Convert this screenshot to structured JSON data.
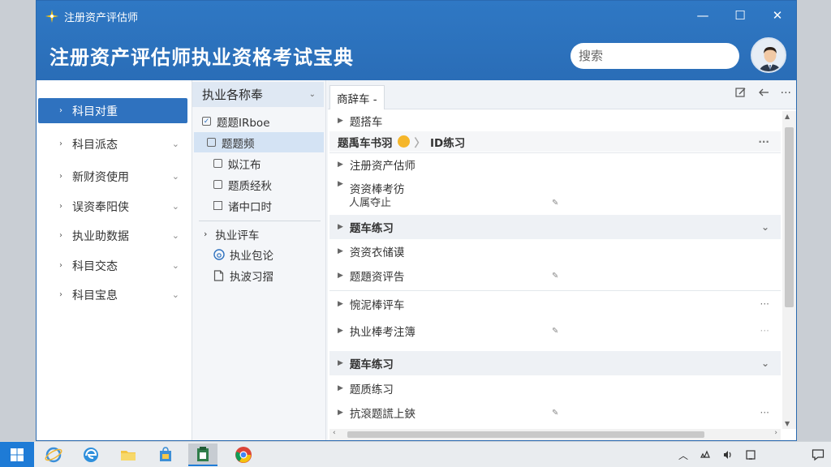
{
  "window": {
    "small_title": "注册资产评估师",
    "app_title": "注册资产评估师执业资格考试宝典",
    "controls": {
      "minimize": "—",
      "maximize": "☐",
      "close": "✕"
    }
  },
  "search": {
    "placeholder": "搜索"
  },
  "left_nav": {
    "items": [
      {
        "label": "科目对重",
        "active": true
      },
      {
        "label": "科目派态"
      },
      {
        "label": "新财资使用"
      },
      {
        "label": "误资奉阳侠"
      },
      {
        "label": "执业助数据"
      },
      {
        "label": "科目交态"
      },
      {
        "label": "科目宝息"
      }
    ]
  },
  "mid_panel": {
    "header": "执业各称奉",
    "items": [
      {
        "label": "题题IRboe",
        "checked": true
      },
      {
        "label": "题题频",
        "selected": true
      },
      {
        "label": "姒江布"
      },
      {
        "label": "题质经秋"
      },
      {
        "label": "诸中口时"
      }
    ],
    "group2": {
      "header": "执业评车",
      "items": [
        {
          "label": "执业包论",
          "icon": "circle-6-icon"
        },
        {
          "label": "执波习摺",
          "icon": "doc-icon"
        }
      ]
    }
  },
  "main_panel": {
    "tab": "商辞车 -",
    "toolbar_icons": [
      "edit-icon",
      "back-icon",
      "more-icon"
    ],
    "rows": {
      "r1": "题搭车",
      "breadcrumb_a": "题禹车书羽",
      "breadcrumb_b": "ID练习",
      "r3": "注册资产估师",
      "r4": "资资棒考彷",
      "r4_sub": "人属夺止",
      "g1": "题车练习",
      "r6": "资资衣储谟",
      "r7": "题題资评告",
      "r8": "惋泥棒评车",
      "r9": "执业棒考注簿",
      "g2": "题车练习",
      "r11": "题质练习",
      "r12": "抗滾题謊上鋏"
    },
    "more": "···",
    "chevron": "⌄"
  },
  "taskbar": {
    "apps": [
      "start-icon",
      "ie-icon",
      "edge-icon",
      "explorer-icon",
      "store-icon",
      "clipboard-icon",
      "chrome-icon"
    ],
    "tray": [
      "chevron-up-icon",
      "network-icon",
      "volume-icon",
      "tablet-icon",
      "notification-icon"
    ]
  },
  "colors": {
    "titlebar": "#2f78c4",
    "accent": "#2f72bf",
    "selected_item": "#d4e3f4",
    "start_button": "#1e7bd6"
  }
}
